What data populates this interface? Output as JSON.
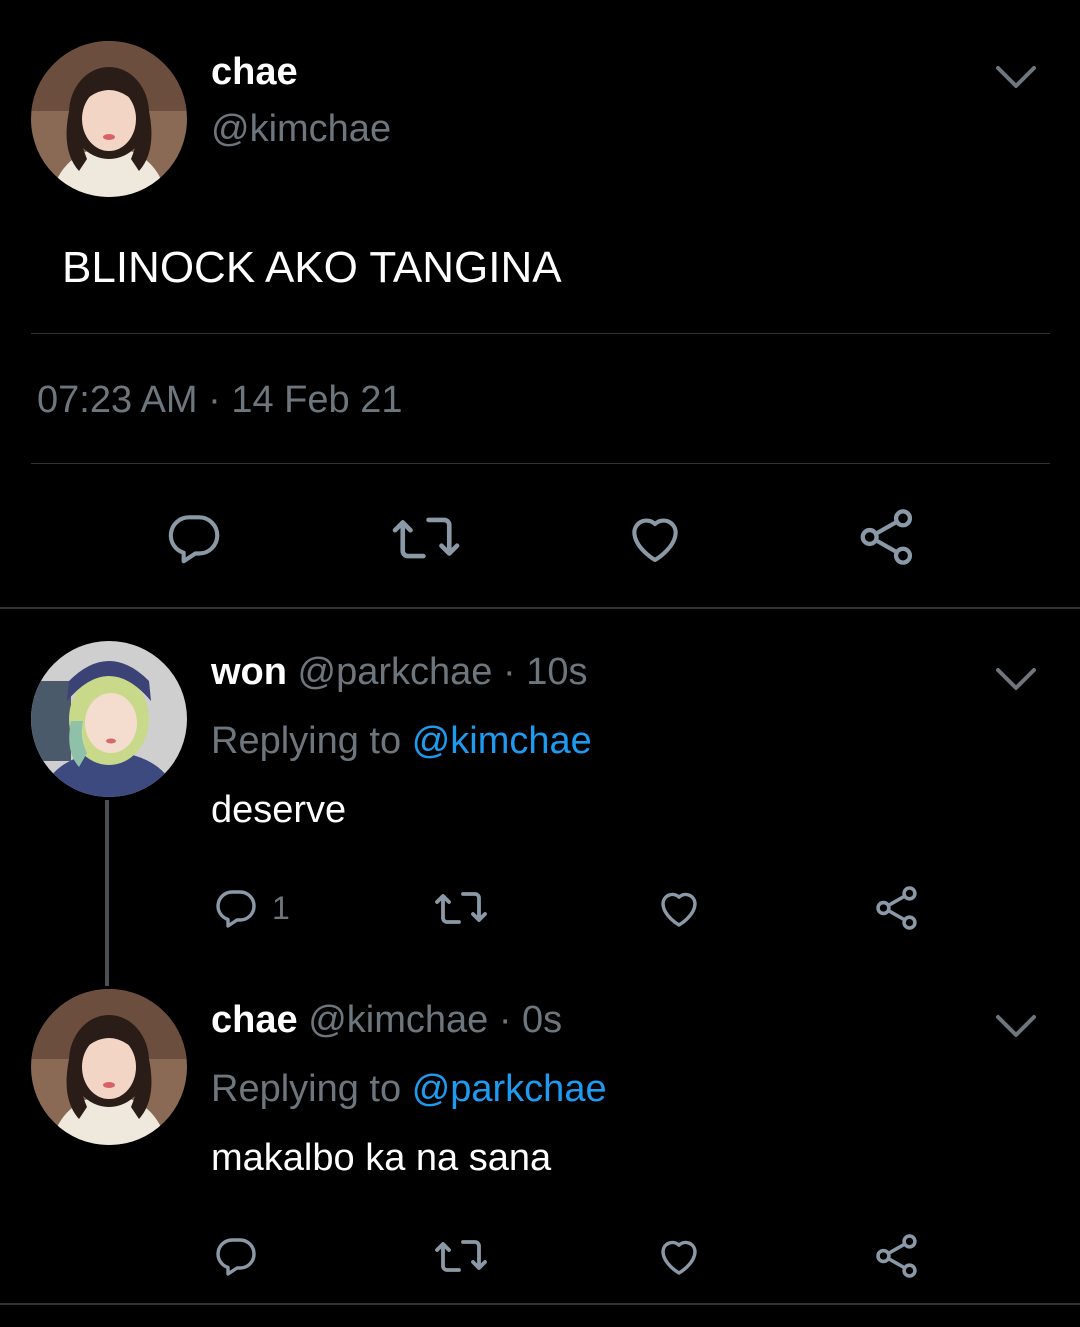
{
  "main_tweet": {
    "author_name": "chae",
    "author_handle": "@kimchae",
    "text": "BLINOCK AKO TANGINA",
    "time": "07:23 AM",
    "separator": "·",
    "date": "14 Feb 21"
  },
  "replies": [
    {
      "author_name": "won",
      "author_handle": "@parkchae",
      "dot": "·",
      "time": "10s",
      "replying_prefix": "Replying to",
      "replying_to": "@kimchae",
      "text": "deserve",
      "reply_count": "1"
    },
    {
      "author_name": "chae",
      "author_handle": "@kimchae",
      "dot": "·",
      "time": "0s",
      "replying_prefix": "Replying to",
      "replying_to": "@parkchae",
      "text": "makalbo ka na sana",
      "reply_count": ""
    }
  ],
  "icons": {
    "reply": "comment-icon",
    "retweet": "retweet-icon",
    "like": "heart-icon",
    "share": "share-icon",
    "menu": "chevron-down-icon"
  },
  "colors": {
    "background": "#000000",
    "text": "#ffffff",
    "muted": "#6e767d",
    "link": "#1d9bf0",
    "divider": "#2f3336"
  }
}
